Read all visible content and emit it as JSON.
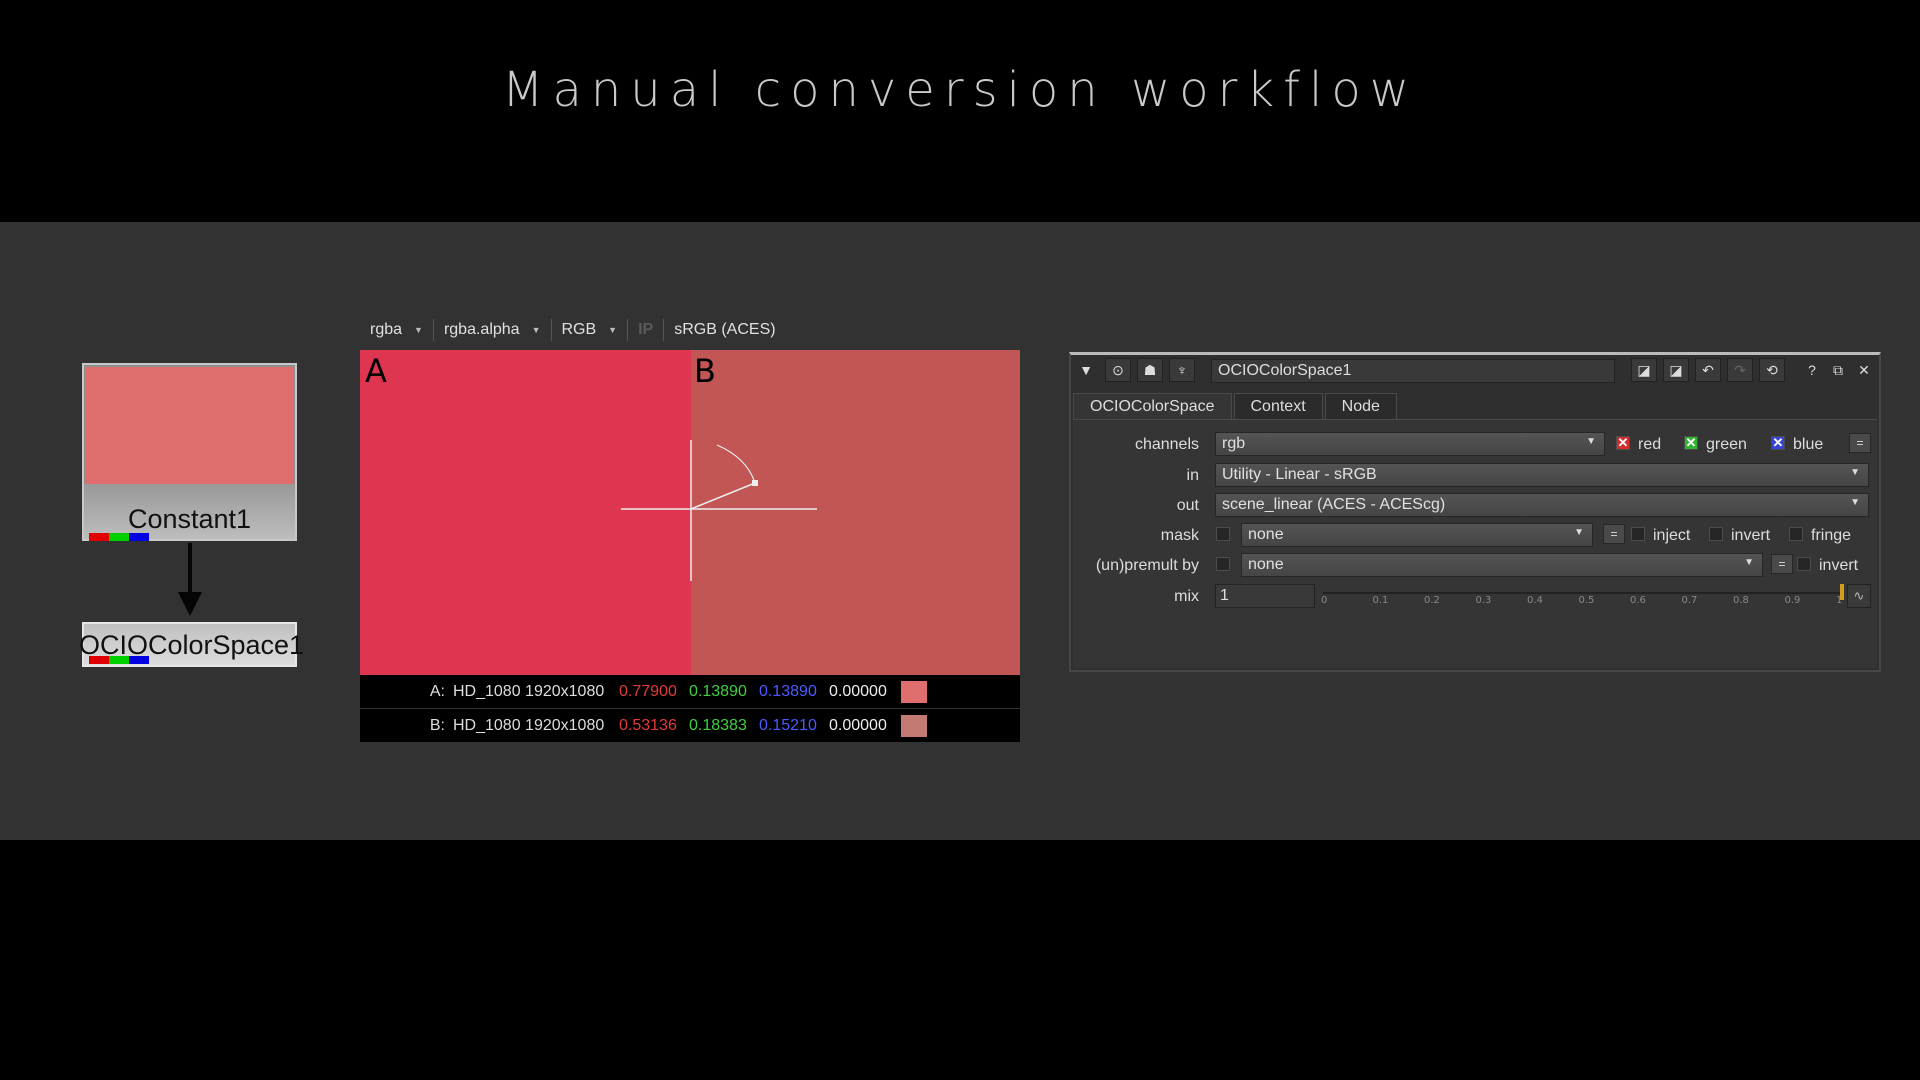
{
  "slide": {
    "title": "Manual conversion workflow"
  },
  "node_graph": {
    "constant_node": {
      "label": "Constant1",
      "swatch_color": "#e06e6e"
    },
    "ocio_node": {
      "label": "OCIOColorSpace1"
    }
  },
  "viewer": {
    "toolbar": {
      "channels": "rgba",
      "alpha": "rgba.alpha",
      "display": "RGB",
      "ip": "IP",
      "lut": "sRGB (ACES)"
    },
    "wipe_a_label": "A",
    "wipe_b_label": "B",
    "a_color": "#de3550",
    "b_color": "#c15654",
    "info_a": {
      "label": "A:",
      "format": "HD_1080 1920x1080",
      "r": "0.77900",
      "g": "0.13890",
      "b": "0.13890",
      "a": "0.00000",
      "swatch": "#e06e6e"
    },
    "info_b": {
      "label": "B:",
      "format": "HD_1080 1920x1080",
      "r": "0.53136",
      "g": "0.18383",
      "b": "0.15210",
      "a": "0.00000",
      "swatch": "#c27a72"
    }
  },
  "panel": {
    "node_name": "OCIOColorSpace1",
    "header_icons": [
      "collapse-icon",
      "viewer-icon",
      "camera-icon",
      "wrench-icon",
      "node-color-icon",
      "node-color-icon-2",
      "undo-icon",
      "redo-icon",
      "revert-icon",
      "help-icon",
      "float-icon",
      "close-icon"
    ],
    "tabs": [
      "OCIOColorSpace",
      "Context",
      "Node"
    ],
    "channels": {
      "label": "channels",
      "value": "rgb",
      "red": "red",
      "green": "green",
      "blue": "blue",
      "eq": "="
    },
    "in": {
      "label": "in",
      "value": "Utility - Linear - sRGB"
    },
    "out": {
      "label": "out",
      "value": "scene_linear (ACES - ACEScg)"
    },
    "mask": {
      "label": "mask",
      "value": "none",
      "eq": "=",
      "inject": "inject",
      "invert": "invert",
      "fringe": "fringe"
    },
    "premult": {
      "label": "(un)premult by",
      "value": "none",
      "eq": "=",
      "invert": "invert"
    },
    "mix": {
      "label": "mix",
      "value": "1",
      "ticks": [
        "0",
        "0.1",
        "0.2",
        "0.3",
        "0.4",
        "0.5",
        "0.6",
        "0.7",
        "0.8",
        "0.9",
        "1"
      ],
      "level": 1.0
    }
  }
}
